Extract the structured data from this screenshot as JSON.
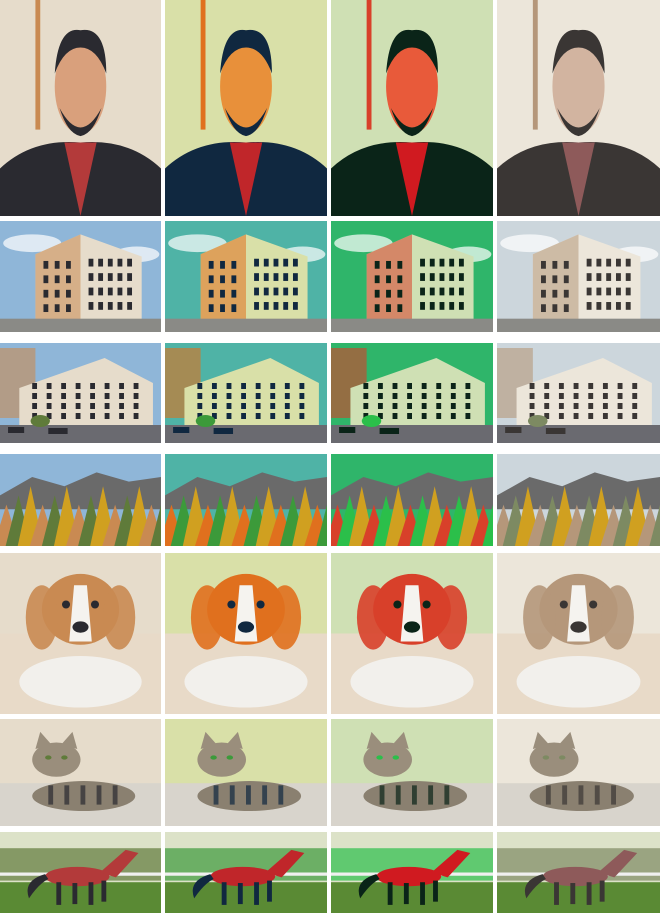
{
  "grid": {
    "columns": [
      "original",
      "style-vivid",
      "style-saturated",
      "style-muted"
    ],
    "rows": [
      {
        "subject": "portrait"
      },
      {
        "subject": "building-corner"
      },
      {
        "subject": "street-building"
      },
      {
        "subject": "autumn-mountains"
      },
      {
        "subject": "beagle"
      },
      {
        "subject": "tabby-cat"
      },
      {
        "subject": "horse"
      }
    ]
  }
}
